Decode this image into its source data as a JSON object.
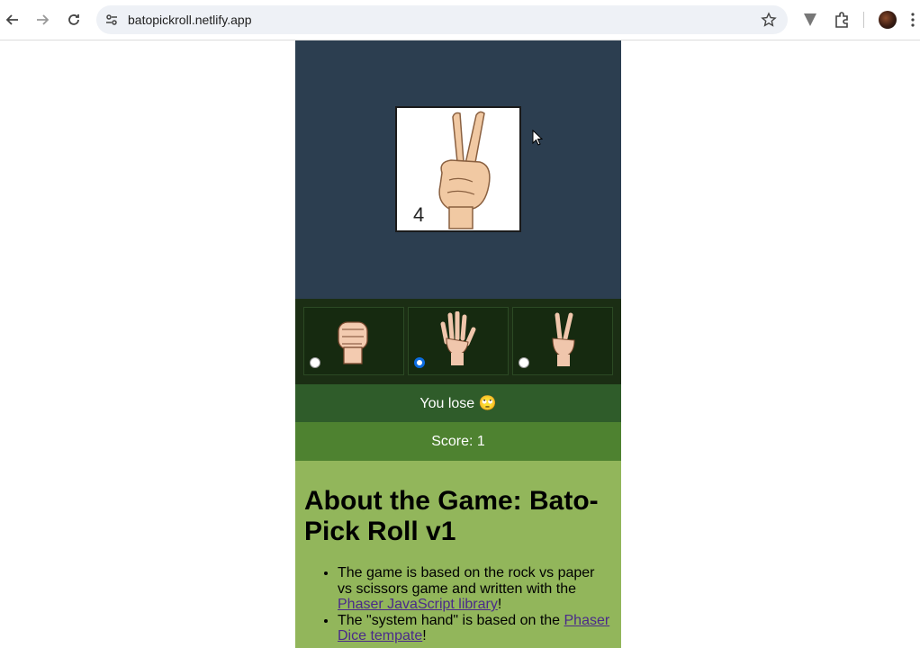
{
  "browser": {
    "url": "batopickroll.netlify.app",
    "back_icon": "arrow-left-icon",
    "forward_icon": "arrow-right-icon",
    "reload_icon": "reload-icon"
  },
  "game": {
    "system_hand_number": "4",
    "choices": [
      {
        "name": "rock",
        "selected": false
      },
      {
        "name": "paper",
        "selected": true
      },
      {
        "name": "scissors",
        "selected": false
      }
    ],
    "result": "You lose 🙄",
    "score": "Score: 1"
  },
  "about": {
    "title": "About the Game: Bato-Pick Roll v1",
    "item1_text_a": "The game is based on the rock vs paper vs scissors game and written with the ",
    "item1_link": "Phaser JavaScript library",
    "item1_text_b": "!",
    "item2_text_a": "The \"system hand\" is based on the ",
    "item2_link": "Phaser Dice tempate",
    "item2_text_b": "!"
  },
  "colors": {
    "game_bg": "#2c3e50",
    "choices_bg": "#1b2e14",
    "result_bg": "#2f5c2a",
    "score_bg": "#4e8230",
    "about_bg": "#92b65b"
  }
}
